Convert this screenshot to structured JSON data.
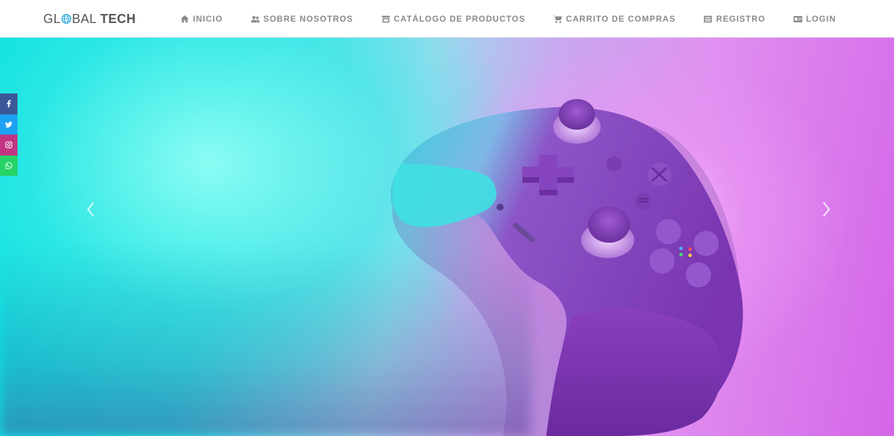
{
  "brand": {
    "part1_a": "GL",
    "part1_b": "BAL",
    "part2": "TECH"
  },
  "nav": {
    "items": [
      {
        "label": "INICIO",
        "icon": "home-icon"
      },
      {
        "label": "SOBRE NOSOTROS",
        "icon": "users-icon"
      },
      {
        "label": "CATÁLOGO DE PRODUCTOS",
        "icon": "store-icon"
      },
      {
        "label": "CARRITO DE COMPRAS",
        "icon": "cart-icon"
      },
      {
        "label": "REGISTRO",
        "icon": "list-icon"
      },
      {
        "label": "LOGIN",
        "icon": "id-card-icon"
      }
    ]
  },
  "social": [
    {
      "name": "facebook",
      "icon": "facebook-icon",
      "color": "#3b5998"
    },
    {
      "name": "twitter",
      "icon": "twitter-icon",
      "color": "#1da1f2"
    },
    {
      "name": "instagram",
      "icon": "instagram-icon",
      "color": "#c13584"
    },
    {
      "name": "whatsapp",
      "icon": "whatsapp-icon",
      "color": "#25d366"
    }
  ],
  "carousel": {
    "prev_icon": "chevron-left-icon",
    "next_icon": "chevron-right-icon"
  },
  "colors": {
    "nav_text": "#8a8a8a",
    "brand_accent": "#1fa3d6",
    "hero_cyan": "#08e0e0",
    "hero_magenta": "#d466e8"
  }
}
